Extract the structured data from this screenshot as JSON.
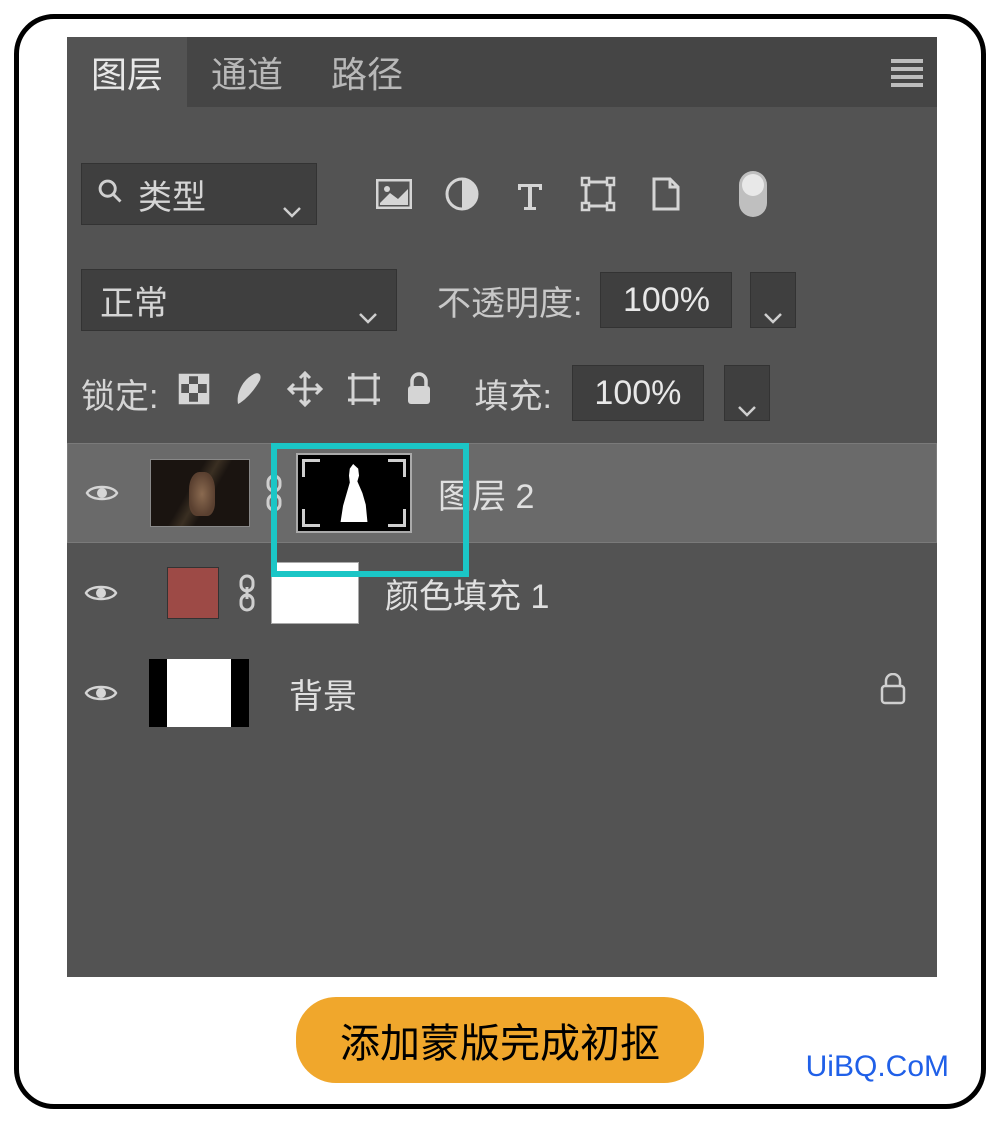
{
  "tabs": {
    "layers": "图层",
    "channels": "通道",
    "paths": "路径"
  },
  "filter": {
    "kind_label": "类型"
  },
  "blend": {
    "mode": "正常",
    "opacity_label": "不透明度:",
    "opacity_value": "100%",
    "lock_label": "锁定:",
    "fill_label": "填充:",
    "fill_value": "100%"
  },
  "layers": {
    "layer2": "图层 2",
    "colorfill1": "颜色填充 1",
    "background": "背景"
  },
  "caption": "添加蒙版完成初抠",
  "watermark": "UiBQ.CoM",
  "colors": {
    "highlight": "#1bc6c6",
    "swatch": "#9d4a46",
    "pill": "#f0a72c"
  }
}
